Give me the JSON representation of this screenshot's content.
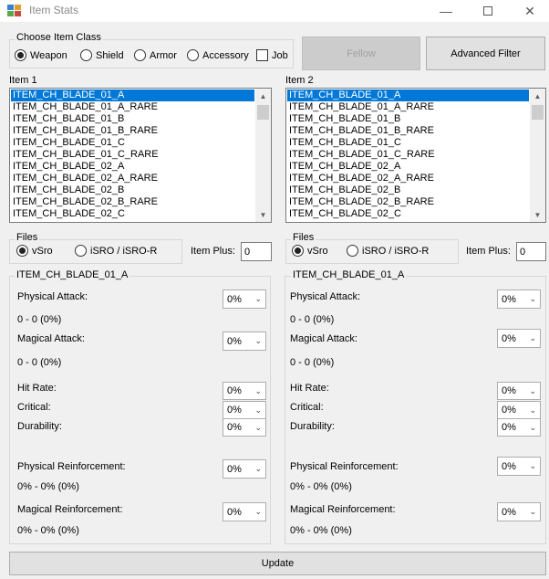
{
  "window": {
    "title": "Item Stats"
  },
  "class_group": {
    "label": "Choose Item Class",
    "options": [
      "Weapon",
      "Shield",
      "Armor",
      "Accessory"
    ],
    "selected": "Weapon",
    "job_label": "Job",
    "job_checked": false
  },
  "buttons": {
    "fellow": "Fellow",
    "advanced_filter": "Advanced Filter",
    "update": "Update"
  },
  "item1": {
    "label": "Item 1",
    "items": [
      "ITEM_CH_BLADE_01_A",
      "ITEM_CH_BLADE_01_A_RARE",
      "ITEM_CH_BLADE_01_B",
      "ITEM_CH_BLADE_01_B_RARE",
      "ITEM_CH_BLADE_01_C",
      "ITEM_CH_BLADE_01_C_RARE",
      "ITEM_CH_BLADE_02_A",
      "ITEM_CH_BLADE_02_A_RARE",
      "ITEM_CH_BLADE_02_B",
      "ITEM_CH_BLADE_02_B_RARE",
      "ITEM_CH_BLADE_02_C"
    ],
    "selected_index": 0
  },
  "item2": {
    "label": "Item 2",
    "items": [
      "ITEM_CH_BLADE_01_A",
      "ITEM_CH_BLADE_01_A_RARE",
      "ITEM_CH_BLADE_01_B",
      "ITEM_CH_BLADE_01_B_RARE",
      "ITEM_CH_BLADE_01_C",
      "ITEM_CH_BLADE_01_C_RARE",
      "ITEM_CH_BLADE_02_A",
      "ITEM_CH_BLADE_02_A_RARE",
      "ITEM_CH_BLADE_02_B",
      "ITEM_CH_BLADE_02_B_RARE",
      "ITEM_CH_BLADE_02_C"
    ],
    "selected_index": 0
  },
  "files_left": {
    "label": "Files",
    "options": [
      "vSro",
      "iSRO / iSRO-R"
    ],
    "selected": "vSro",
    "item_plus_label": "Item Plus:",
    "item_plus_value": "0"
  },
  "files_right": {
    "label": "Files",
    "options": [
      "vSro",
      "iSRO / iSRO-R"
    ],
    "selected": "vSro",
    "item_plus_label": "Item Plus:",
    "item_plus_value": "0"
  },
  "stats_left": {
    "title": "ITEM_CH_BLADE_01_A",
    "physical_attack_label": "Physical Attack:",
    "physical_attack_value": "0 - 0 (0%)",
    "physical_attack_pct": "0%",
    "magical_attack_label": "Magical Attack:",
    "magical_attack_value": "0 - 0 (0%)",
    "magical_attack_pct": "0%",
    "hit_rate_label": "Hit Rate:",
    "hit_rate_pct": "0%",
    "critical_label": "Critical:",
    "critical_pct": "0%",
    "durability_label": "Durability:",
    "durability_pct": "0%",
    "phys_reinf_label": "Physical Reinforcement:",
    "phys_reinf_value": "0% - 0% (0%)",
    "phys_reinf_pct": "0%",
    "mag_reinf_label": "Magical Reinforcement:",
    "mag_reinf_value": "0% - 0% (0%)",
    "mag_reinf_pct": "0%"
  },
  "stats_right": {
    "title": "ITEM_CH_BLADE_01_A",
    "physical_attack_label": "Physical Attack:",
    "physical_attack_value": "0 - 0 (0%)",
    "physical_attack_pct": "0%",
    "magical_attack_label": "Magical Attack:",
    "magical_attack_value": "0 - 0 (0%)",
    "magical_attack_pct": "0%",
    "hit_rate_label": "Hit Rate:",
    "hit_rate_pct": "0%",
    "critical_label": "Critical:",
    "critical_pct": "0%",
    "durability_label": "Durability:",
    "durability_pct": "0%",
    "phys_reinf_label": "Physical Reinforcement:",
    "phys_reinf_value": "0% - 0% (0%)",
    "phys_reinf_pct": "0%",
    "mag_reinf_label": "Magical Reinforcement:",
    "mag_reinf_value": "0% - 0% (0%)",
    "mag_reinf_pct": "0%"
  },
  "colors": {
    "selection": "#0078d7",
    "window_bg": "#f0f0f0"
  }
}
